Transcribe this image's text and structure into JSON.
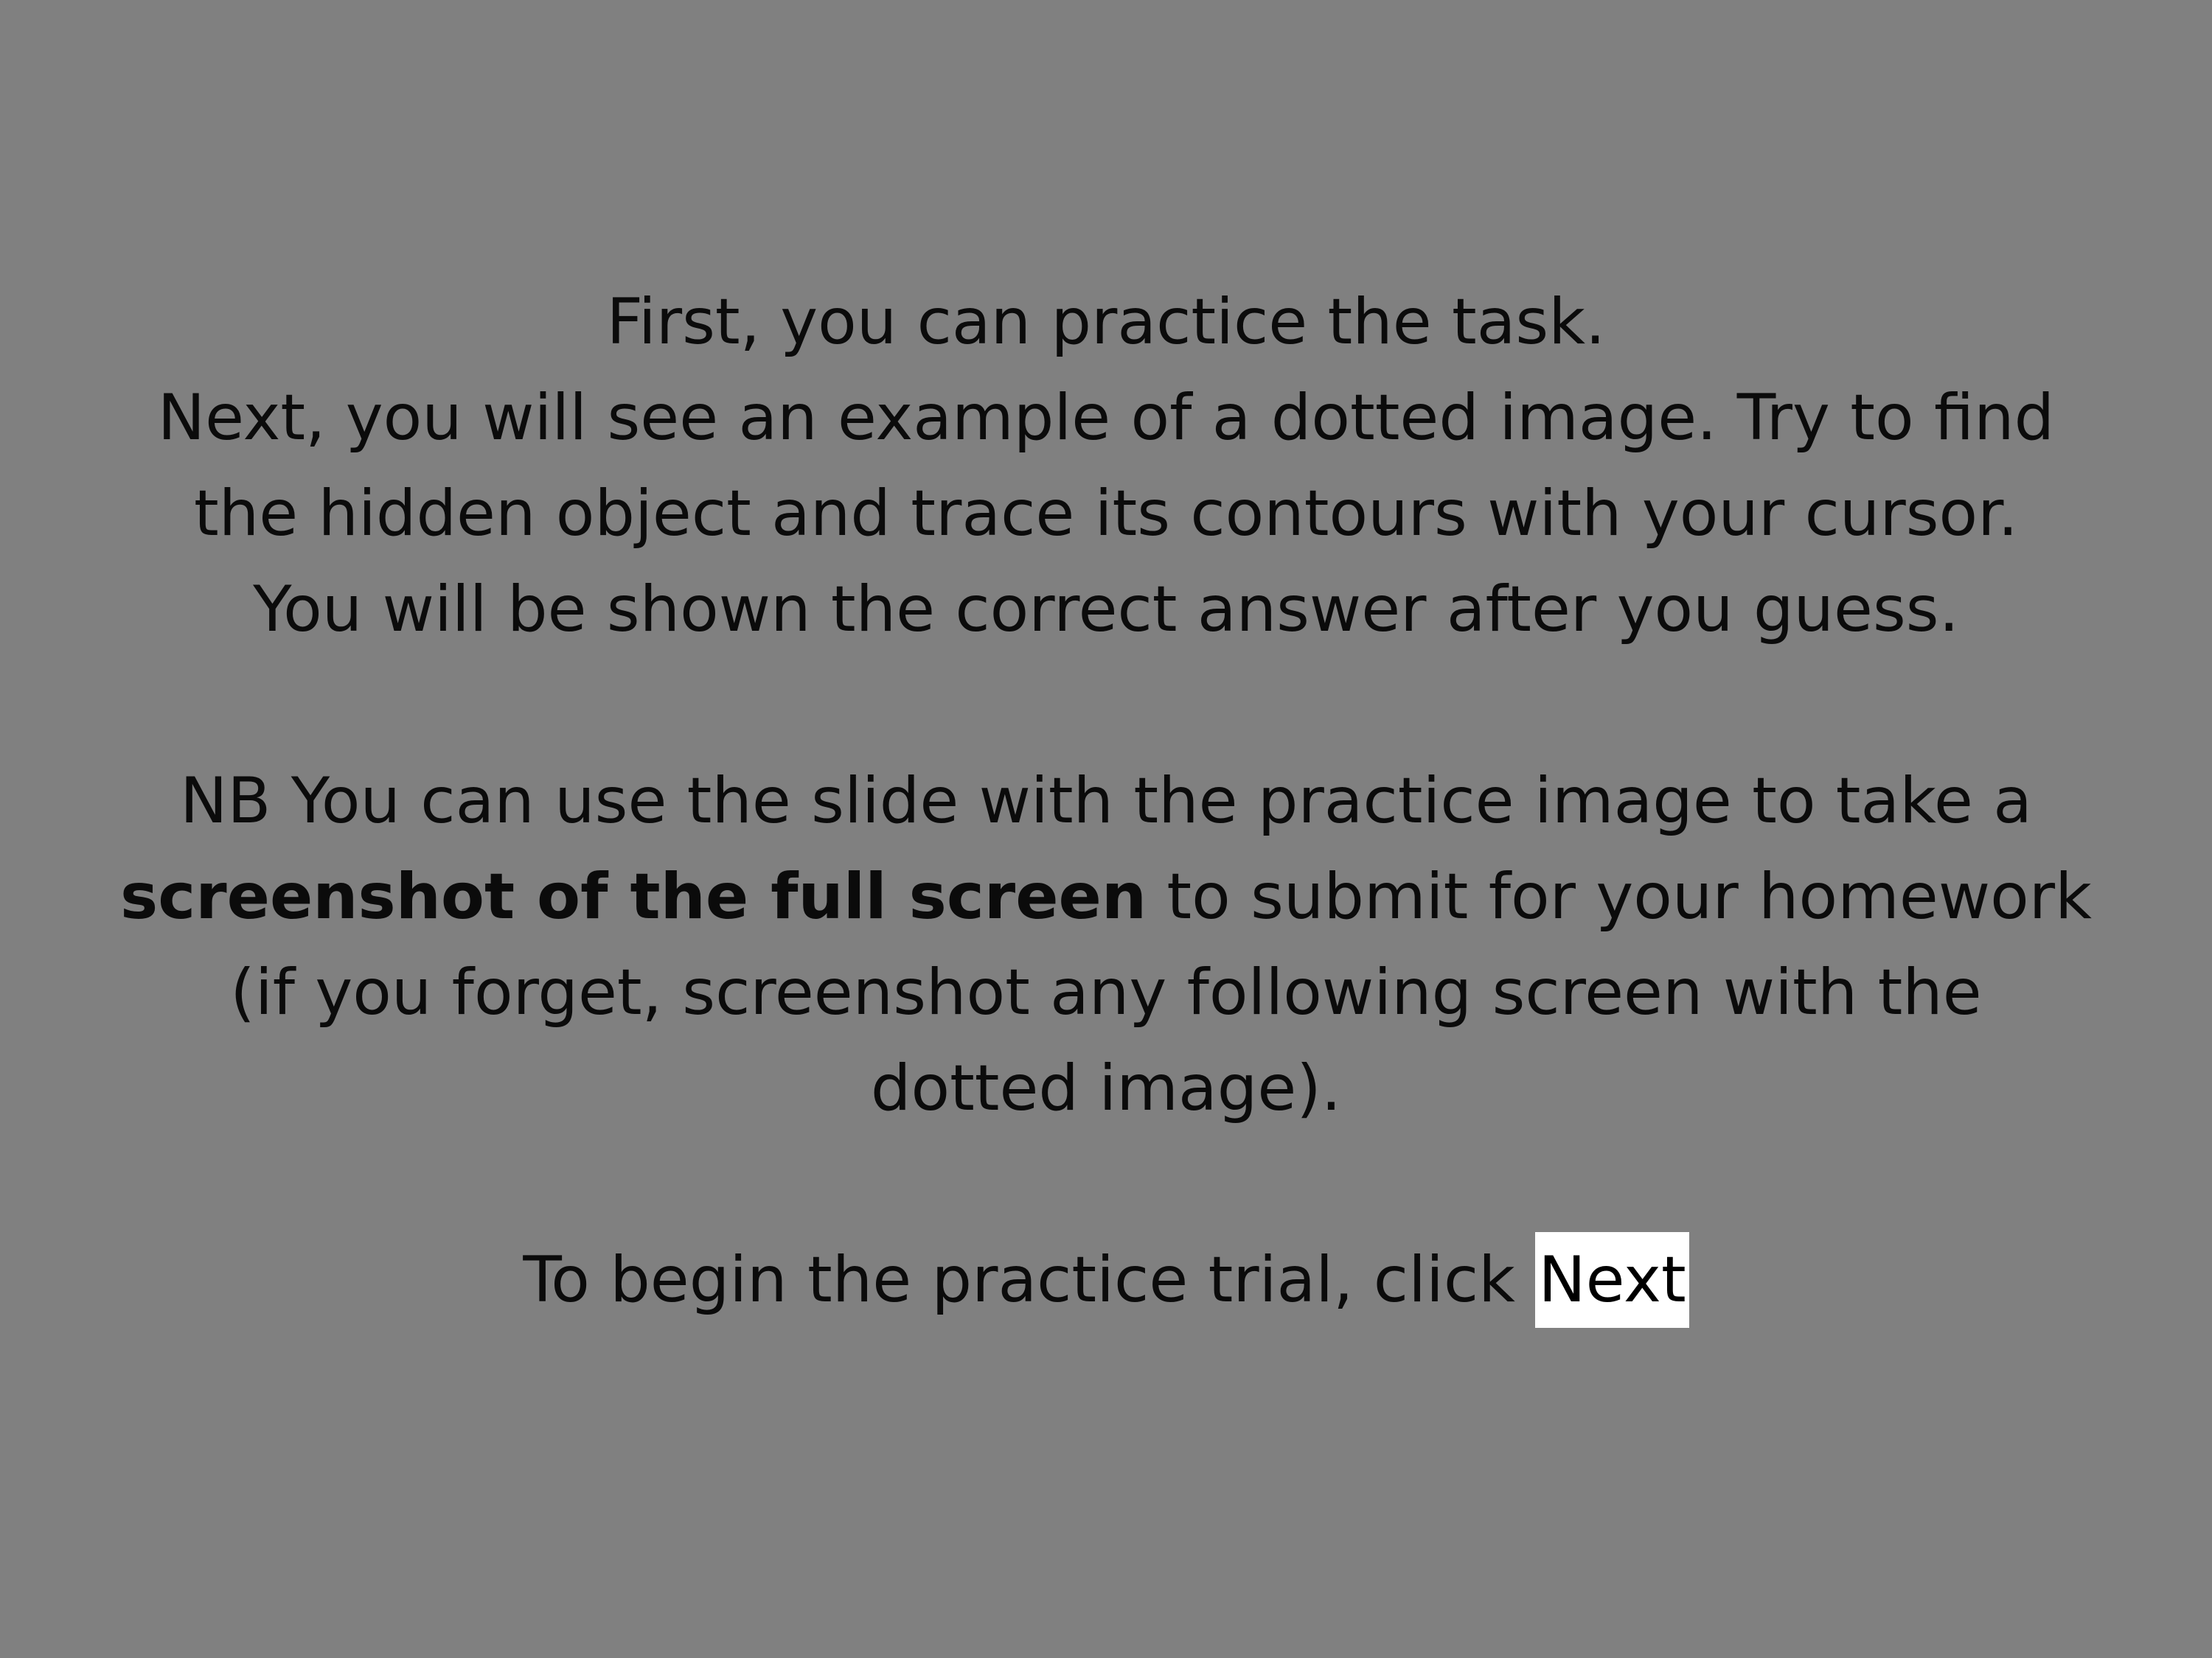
{
  "instructions": {
    "line1": "First, you can practice the task.",
    "line2": "Next, you will see an example of a dotted image. Try to find",
    "line3": "the hidden object and trace its contours with your cursor.",
    "line4": "You will be shown the correct answer after you guess.",
    "line5": "NB You can use the slide with the practice image to take a",
    "line6_bold": "screenshot of the full screen",
    "line6_rest": " to submit for your homework",
    "line7": "(if you forget, screenshot any following screen with the",
    "line8": "dotted image)."
  },
  "cta": {
    "prefix": "To begin the practice trial, click ",
    "next_label": "Next"
  },
  "colors": {
    "background": "#808080",
    "text": "#0b0b0b",
    "button_bg": "#ffffff"
  }
}
